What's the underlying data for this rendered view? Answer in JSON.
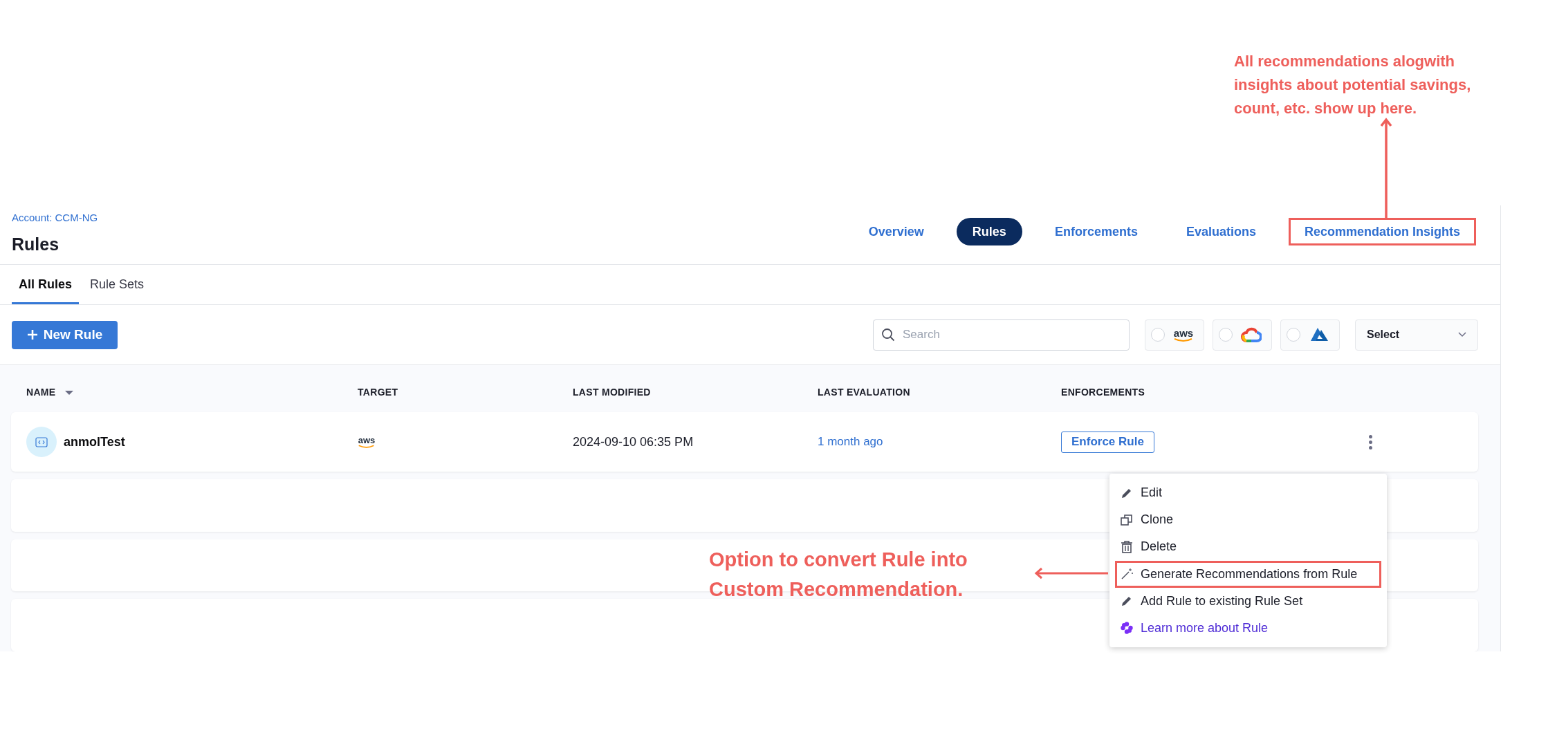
{
  "header": {
    "breadcrumb": "Account: CCM-NG",
    "title": "Rules"
  },
  "nav_tabs": [
    {
      "label": "Overview",
      "selected": false,
      "highlighted": false
    },
    {
      "label": "Rules",
      "selected": true,
      "highlighted": false
    },
    {
      "label": "Enforcements",
      "selected": false,
      "highlighted": false
    },
    {
      "label": "Evaluations",
      "selected": false,
      "highlighted": false
    },
    {
      "label": "Recommendation Insights",
      "selected": false,
      "highlighted": true
    }
  ],
  "sub_tabs": [
    {
      "label": "All Rules",
      "selected": true
    },
    {
      "label": "Rule Sets",
      "selected": false
    }
  ],
  "toolbar": {
    "new_button": "New Rule",
    "search": {
      "placeholder": "Search"
    },
    "providers": [
      {
        "kind": "aws",
        "logo_text": "aws",
        "selected": false
      },
      {
        "kind": "gcp",
        "selected": false
      },
      {
        "kind": "azure",
        "selected": false
      }
    ],
    "select": "Select"
  },
  "table": {
    "columns": [
      {
        "label": "NAME",
        "sortable": true
      },
      {
        "label": "TARGET",
        "sortable": false
      },
      {
        "label": "LAST MODIFIED",
        "sortable": false
      },
      {
        "label": "LAST EVALUATION",
        "sortable": false
      },
      {
        "label": "ENFORCEMENTS",
        "sortable": false
      }
    ],
    "rows": [
      {
        "name": "anmolTest",
        "target": {
          "kind": "aws",
          "logo_text": "aws"
        },
        "last_modified": "2024-09-10 06:35 PM",
        "last_evaluation": "1 month ago",
        "action": "Enforce Rule"
      }
    ]
  },
  "row_menu": {
    "items": [
      {
        "kind": "edit",
        "label": "Edit",
        "highlighted": false
      },
      {
        "kind": "clone",
        "label": "Clone",
        "highlighted": false
      },
      {
        "kind": "delete",
        "label": "Delete",
        "highlighted": false
      },
      {
        "kind": "generate",
        "label": "Generate Recommendations from Rule",
        "highlighted": true
      },
      {
        "kind": "edit",
        "label": "Add Rule to existing Rule Set",
        "highlighted": false
      },
      {
        "kind": "learn",
        "label": "Learn more about Rule",
        "highlighted": false
      }
    ]
  },
  "annotations": [
    {
      "kind": "up",
      "text": "All recommendations alogwith\ninsights about potential savings,\ncount, etc. show up here."
    },
    {
      "kind": "left",
      "text": "Option to convert Rule into\nCustom Recommendation."
    }
  ]
}
